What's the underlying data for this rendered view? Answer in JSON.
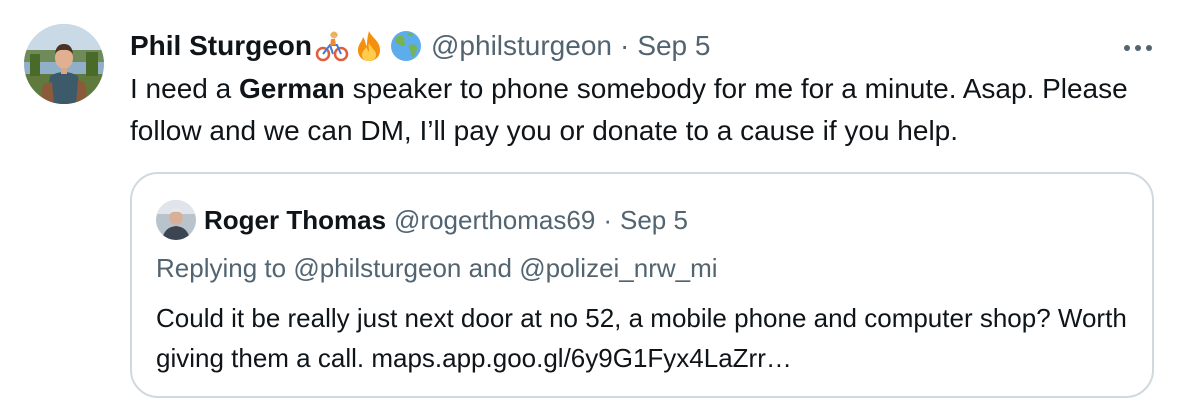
{
  "tweet": {
    "author": {
      "display_name": "Phil Sturgeon",
      "emojis": [
        "bicycle-rider-icon",
        "fire-icon",
        "globe-icon"
      ],
      "handle": "@philsturgeon",
      "separator": "·",
      "date": "Sep 5"
    },
    "text": {
      "part1": "I need a ",
      "bold": "German",
      "part2": " speaker to phone somebody for me for a minute. Asap. Please follow and we can DM, I’ll pay you or donate to a cause if you help."
    },
    "more_label": "···"
  },
  "quote": {
    "author": {
      "display_name": "Roger Thomas",
      "handle": "@rogerthomas69",
      "separator": "·",
      "date": "Sep 5"
    },
    "reply": {
      "prefix": "Replying to ",
      "mention1": "@philsturgeon",
      "and": " and ",
      "mention2": "@polizei_nrw_mi"
    },
    "text": {
      "body": "Could it be really just next door at no 52, a mobile phone and computer shop? Worth giving them a call. ",
      "link": "maps.app.goo.gl/6y9G1Fyx4LaZrr…"
    }
  },
  "colors": {
    "text_primary": "#0f1419",
    "text_secondary": "#536471",
    "border": "#cfd9de"
  }
}
